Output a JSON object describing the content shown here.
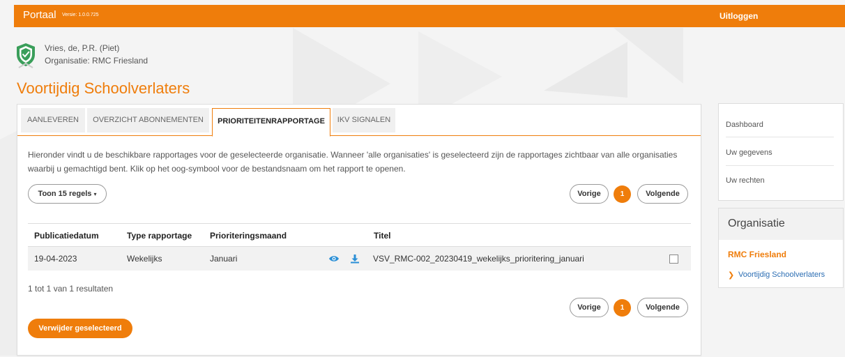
{
  "header": {
    "brand": "Portaal",
    "version": "Versie: 1.0.0.725",
    "logout_label": "Uitloggen"
  },
  "user": {
    "name": "Vries, de, P.R. (Piet)",
    "organisation": "Organisatie: RMC Friesland"
  },
  "page_title": "Voortijdig Schoolverlaters",
  "tabs": [
    {
      "label": "AANLEVEREN"
    },
    {
      "label": "OVERZICHT ABONNEMENTEN"
    },
    {
      "label": "PRIORITEITENRAPPORTAGE"
    },
    {
      "label": "IKV SIGNALEN"
    }
  ],
  "intro_text": "Hieronder vindt u de beschikbare rapportages voor de geselecteerde organisatie. Wanneer 'alle organisaties' is geselecteerd zijn de rapportages zichtbaar van alle organisaties waarbij u gemachtigd bent. Klik op het oog-symbool voor de bestandsnaam om het rapport te openen.",
  "rows_dropdown": "Toon 15 regels",
  "pagination": {
    "prev_label": "Vorige",
    "current_page": "1",
    "next_label": "Volgende"
  },
  "table": {
    "headers": [
      "Publicatiedatum",
      "Type rapportage",
      "Prioriteringsmaand",
      "Titel"
    ],
    "rows": [
      {
        "date": "19-04-2023",
        "type": "Wekelijks",
        "month": "Januari",
        "title": "VSV_RMC-002_20230419_wekelijks_prioritering_januari"
      }
    ]
  },
  "results_text": "1 tot 1 van 1 resultaten",
  "delete_selected_label": "Verwijder geselecteerd",
  "side_nav": {
    "items": [
      {
        "label": "Dashboard"
      },
      {
        "label": "Uw gegevens"
      },
      {
        "label": "Uw rechten"
      }
    ]
  },
  "organisation_box": {
    "title": "Organisatie",
    "name": "RMC Friesland",
    "link": "Voortijdig Schoolverlaters"
  },
  "colors": {
    "accent": "#ef7d0b",
    "link": "#2b6db3",
    "shield": "#3a9e5a"
  },
  "icons": [
    "shield-check-icon",
    "chevron-down-icon",
    "eye-icon",
    "download-icon",
    "chevron-right-icon"
  ]
}
